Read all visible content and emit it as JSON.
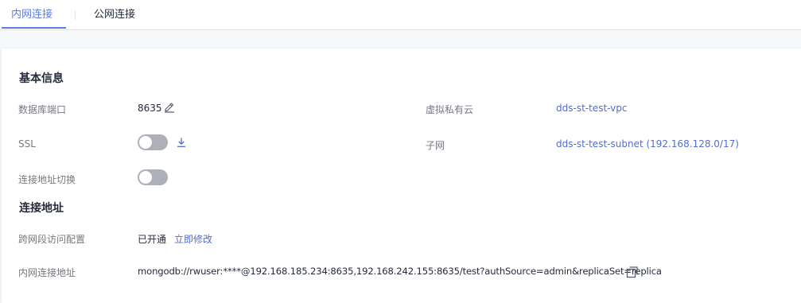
{
  "tabs": {
    "intranet_label": "内网连接",
    "public_label": "公网连接",
    "active": "intranet"
  },
  "basic_info": {
    "title": "基本信息",
    "db_port_label": "数据库端口",
    "db_port_value": "8635",
    "vpc_label": "虚拟私有云",
    "vpc_value": "dds-st-test-vpc",
    "ssl_label": "SSL",
    "ssl_enabled": false,
    "subnet_label": "子网",
    "subnet_value": "dds-st-test-subnet (192.168.128.0/17)",
    "addr_switch_label": "连接地址切换",
    "addr_switch_enabled": false
  },
  "connection": {
    "title": "连接地址",
    "cross_segment_label": "跨网段访问配置",
    "cross_segment_status": "已开通",
    "cross_segment_action": "立即修改",
    "intranet_addr_label": "内网连接地址",
    "intranet_addr_value": "mongodb://rwuser:****@192.168.185.234:8635,192.168.242.155:8635/test?authSource=admin&replicaSet=replica"
  },
  "icons": {
    "edit": "pencil-edit-icon",
    "download": "download-icon",
    "copy": "copy-icon"
  },
  "colors": {
    "accent": "#5e7ce0",
    "link": "#526ecc",
    "toggle_off": "#adb0b8",
    "label": "#75787f"
  }
}
